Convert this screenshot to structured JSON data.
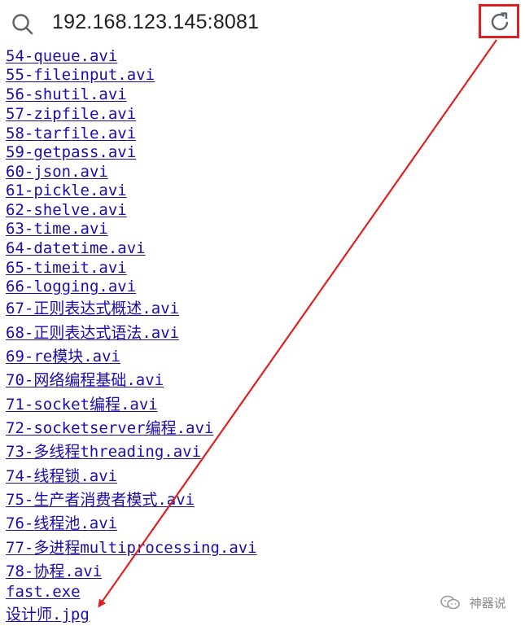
{
  "address_bar": {
    "url": "192.168.123.145:8081",
    "search_icon": "search-icon",
    "reload_icon": "reload-icon"
  },
  "colors": {
    "link": "#1a0dab",
    "annotation": "#e02020",
    "url_text": "#202124"
  },
  "files": [
    "54-queue.avi",
    "55-fileinput.avi",
    "56-shutil.avi",
    "57-zipfile.avi",
    "58-tarfile.avi",
    "59-getpass.avi",
    "60-json.avi",
    "61-pickle.avi",
    "62-shelve.avi",
    "63-time.avi",
    "64-datetime.avi",
    "65-timeit.avi",
    "66-logging.avi",
    "67-正则表达式概述.avi",
    "68-正则表达式语法.avi",
    "69-re模块.avi",
    "70-网络编程基础.avi",
    "71-socket编程.avi",
    "72-socketserver编程.avi",
    "73-多线程threading.avi",
    "74-线程锁.avi",
    "75-生产者消费者模式.avi",
    "76-线程池.avi",
    "77-多进程multiprocessing.avi",
    "78-协程.avi",
    "fast.exe",
    "设计师.jpg"
  ],
  "watermark": {
    "text": "神器说",
    "icon": "wechat-icon"
  }
}
